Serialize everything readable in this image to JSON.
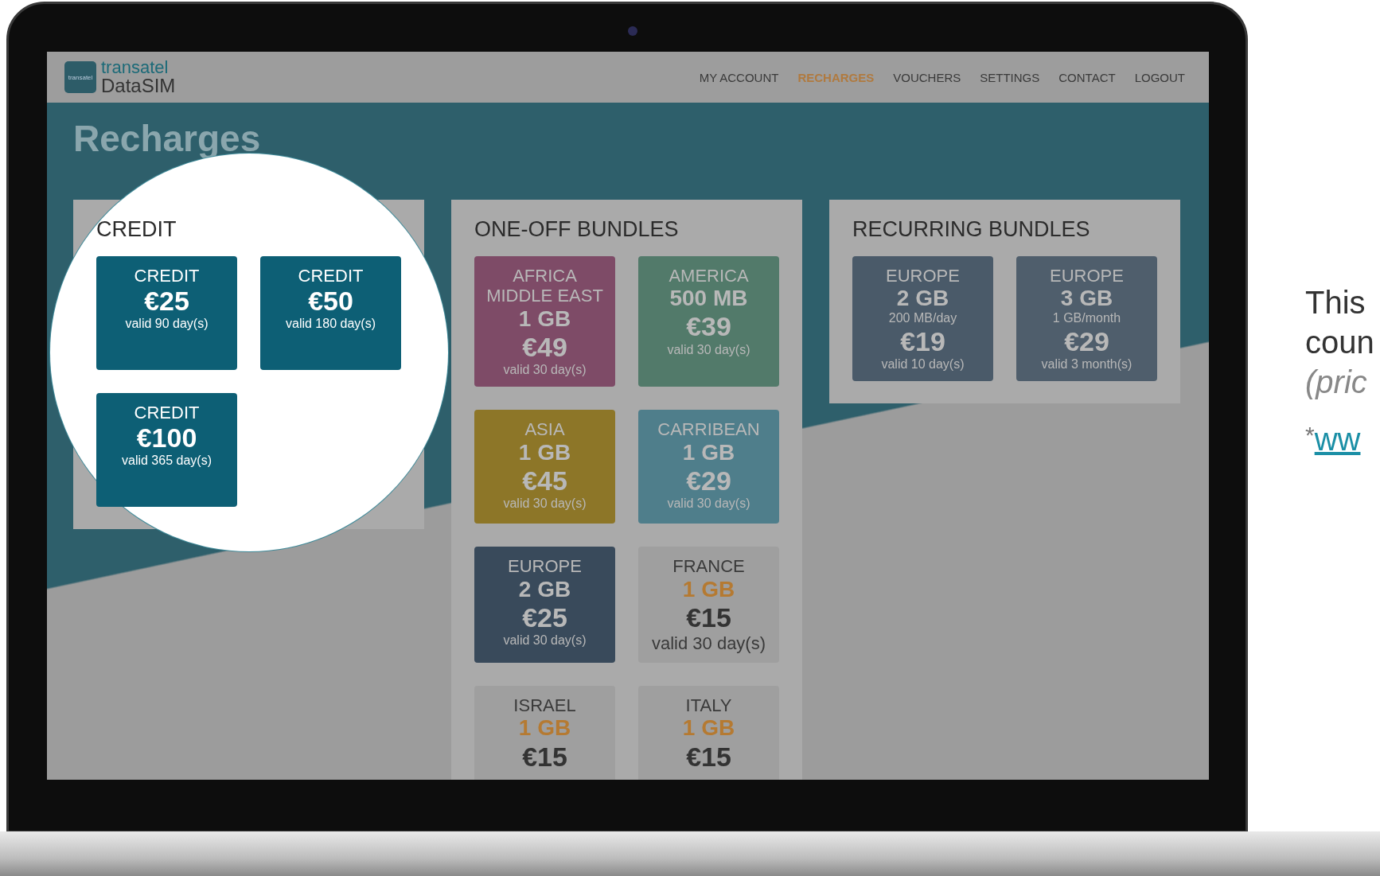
{
  "logo": {
    "line_1": "transatel",
    "line_2": "DataSIM",
    "badge": "transatel"
  },
  "nav": [
    {
      "label": "MY ACCOUNT",
      "selected": false
    },
    {
      "label": "RECHARGES",
      "selected": true
    },
    {
      "label": "VOUCHERS",
      "selected": false
    },
    {
      "label": "SETTINGS",
      "selected": false
    },
    {
      "label": "CONTACT",
      "selected": false
    },
    {
      "label": "LOGOUT",
      "selected": false
    }
  ],
  "page_title": "Recharges",
  "sections": [
    {
      "title": "CREDIT",
      "highlighted": true,
      "tiles": [
        {
          "color": "#0d5f75",
          "lines": [
            {
              "kind": "label",
              "text": "CREDIT"
            },
            {
              "kind": "price",
              "text": "€25"
            },
            {
              "kind": "validity",
              "text": "valid 90 day(s)"
            }
          ]
        },
        {
          "color": "#0d5f75",
          "lines": [
            {
              "kind": "label",
              "text": "CREDIT"
            },
            {
              "kind": "price",
              "text": "€50"
            },
            {
              "kind": "validity",
              "text": "valid 180 day(s)"
            }
          ]
        },
        {
          "color": "#0d5f75",
          "lines": [
            {
              "kind": "label",
              "text": "CREDIT"
            },
            {
              "kind": "price",
              "text": "€100"
            },
            {
              "kind": "validity",
              "text": "valid 365 day(s)"
            }
          ]
        }
      ]
    },
    {
      "title": "ONE-OFF BUNDLES",
      "highlighted": false,
      "tiles": [
        {
          "color": "#7e4b67",
          "lines": [
            {
              "kind": "label",
              "text": "AFRICA"
            },
            {
              "kind": "label",
              "text": "MIDDLE EAST"
            },
            {
              "kind": "size",
              "text": "1 GB"
            },
            {
              "kind": "price",
              "text": "€49"
            },
            {
              "kind": "validity",
              "text": "valid 30 day(s)"
            }
          ]
        },
        {
          "color": "#527a6a",
          "lines": [
            {
              "kind": "label",
              "text": "AMERICA"
            },
            {
              "kind": "size",
              "text": "500 MB"
            },
            {
              "kind": "price",
              "text": "€39"
            },
            {
              "kind": "validity",
              "text": "valid 30 day(s)"
            }
          ]
        },
        {
          "color": "#8d7628",
          "lines": [
            {
              "kind": "label",
              "text": "ASIA"
            },
            {
              "kind": "size",
              "text": "1 GB"
            },
            {
              "kind": "price",
              "text": "€45"
            },
            {
              "kind": "validity",
              "text": "valid 30 day(s)"
            }
          ]
        },
        {
          "color": "#4f7e8b",
          "lines": [
            {
              "kind": "label",
              "text": "CARRIBEAN"
            },
            {
              "kind": "size",
              "text": "1 GB"
            },
            {
              "kind": "price",
              "text": "€29"
            },
            {
              "kind": "validity",
              "text": "valid 30 day(s)"
            }
          ]
        },
        {
          "color": "#394a5b",
          "lines": [
            {
              "kind": "label",
              "text": "EUROPE"
            },
            {
              "kind": "size",
              "text": "2 GB"
            },
            {
              "kind": "price",
              "text": "€25"
            },
            {
              "kind": "validity",
              "text": "valid 30 day(s)"
            }
          ]
        },
        {
          "color": "#9f9f9f",
          "lines": [
            {
              "kind": "dark",
              "text": "FRANCE"
            },
            {
              "kind": "accent",
              "text": "1 GB"
            },
            {
              "kind": "darkprice",
              "text": "€15"
            },
            {
              "kind": "dark",
              "text": "valid 30 day(s)"
            }
          ]
        },
        {
          "color": "#9f9f9f",
          "lines": [
            {
              "kind": "dark",
              "text": "ISRAEL"
            },
            {
              "kind": "accent",
              "text": "1 GB"
            },
            {
              "kind": "darkprice",
              "text": "€15"
            }
          ]
        },
        {
          "color": "#9f9f9f",
          "lines": [
            {
              "kind": "dark",
              "text": "ITALY"
            },
            {
              "kind": "accent",
              "text": "1 GB"
            },
            {
              "kind": "darkprice",
              "text": "€15"
            }
          ]
        }
      ]
    },
    {
      "title": "RECURRING BUNDLES",
      "highlighted": false,
      "tiles": [
        {
          "color": "#4a5a69",
          "lines": [
            {
              "kind": "label",
              "text": "EUROPE"
            },
            {
              "kind": "size",
              "text": "2 GB"
            },
            {
              "kind": "note",
              "text": "200 MB/day"
            },
            {
              "kind": "price",
              "text": "€19"
            },
            {
              "kind": "validity",
              "text": "valid 10 day(s)"
            }
          ]
        },
        {
          "color": "#4f5e6c",
          "lines": [
            {
              "kind": "label",
              "text": "EUROPE"
            },
            {
              "kind": "size",
              "text": "3 GB"
            },
            {
              "kind": "note",
              "text": "1 GB/month"
            },
            {
              "kind": "price",
              "text": "€29"
            },
            {
              "kind": "validity",
              "text": "valid 3 month(s)"
            }
          ]
        }
      ]
    }
  ],
  "side_text": {
    "lines": [
      "This",
      "coun"
    ],
    "note": "(pric",
    "star": "*",
    "link": "ww"
  }
}
